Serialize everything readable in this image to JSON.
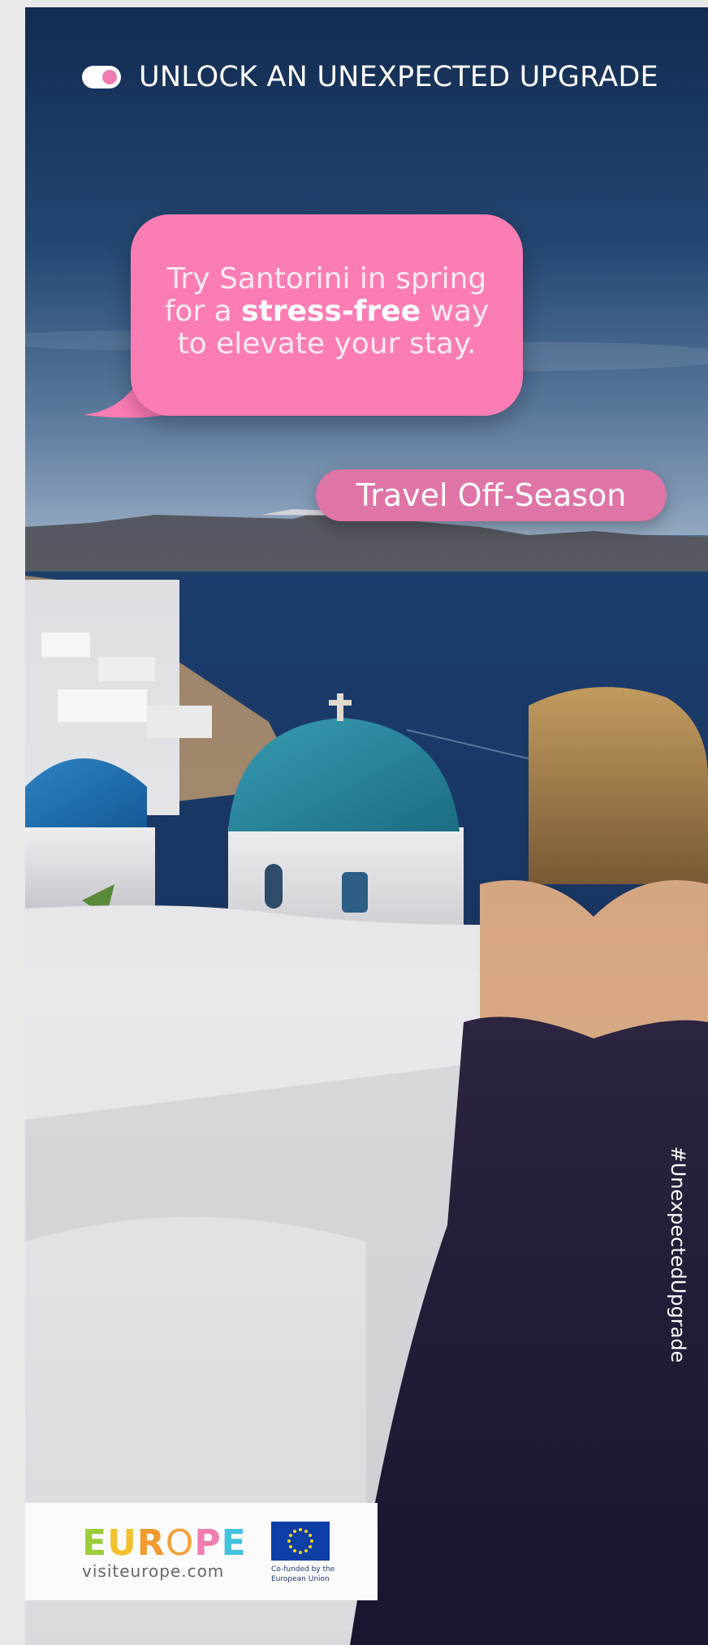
{
  "header": {
    "toggle_icon": "toggle-on-icon",
    "headline": "UNLOCK AN UNEXPECTED UPGRADE"
  },
  "bubble": {
    "line1": "Try Santorini in spring",
    "line2_pre": "for a ",
    "line2_bold": "stress-free",
    "line2_post": " way",
    "line3": "to elevate your stay."
  },
  "cta": {
    "label": "Travel Off-Season"
  },
  "hashtag": "#UnexpectedUpgrade",
  "footer": {
    "brand_letters": [
      "E",
      "U",
      "R",
      "O",
      "P",
      "E"
    ],
    "site": "visiteurope.com",
    "eu_icon": "eu-flag-icon",
    "eu_text": "Co-funded by the European Union"
  },
  "colors": {
    "pink": "#fc7db4",
    "pill_pink": "#df74a6",
    "brand": [
      "#9bcc3b",
      "#f2c12e",
      "#f29b30",
      "#f4a13a",
      "#ef7fae",
      "#44c1dc"
    ]
  }
}
